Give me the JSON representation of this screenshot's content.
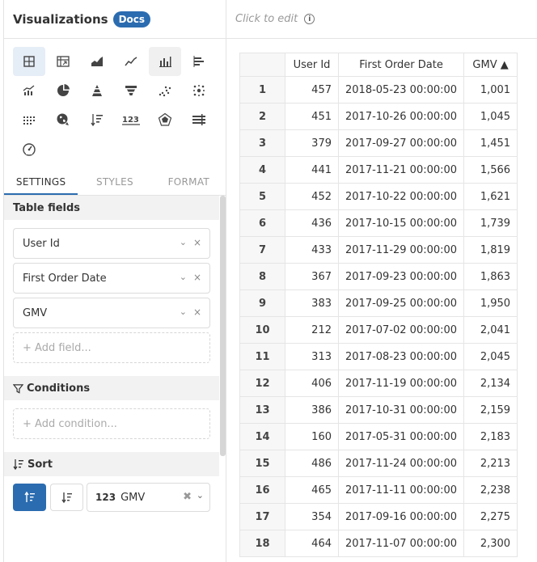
{
  "panel": {
    "title": "Visualizations",
    "docs_badge": "Docs"
  },
  "viz_icons": [
    "table-icon",
    "pivot-table-icon",
    "area-chart-icon",
    "line-chart-icon",
    "column-chart-icon",
    "bar-chart-icon",
    "combo-chart-icon",
    "pie-chart-icon",
    "pyramid-chart-icon",
    "funnel-chart-icon",
    "scatter-chart-icon",
    "heatmap-icon",
    "dot-matrix-icon",
    "geo-map-icon",
    "sorted-list-icon",
    "number-metric-icon",
    "radar-chart-icon",
    "bullet-chart-icon",
    "gauge-icon"
  ],
  "tabs": {
    "settings": "SETTINGS",
    "styles": "STYLES",
    "format": "FORMAT"
  },
  "table_fields": {
    "heading": "Table fields",
    "items": [
      {
        "label": "User Id"
      },
      {
        "label": "First Order Date"
      },
      {
        "label": "GMV"
      }
    ],
    "add_placeholder": "+ Add field..."
  },
  "conditions": {
    "heading": "Conditions",
    "add_placeholder": "+ Add condition..."
  },
  "sort": {
    "heading": "Sort",
    "field_type": "123",
    "field_label": "GMV"
  },
  "editor": {
    "placeholder": "Click to edit",
    "info_glyph": "i"
  },
  "table": {
    "columns": [
      "User Id",
      "First Order Date",
      "GMV ▲"
    ],
    "rows": [
      [
        "1",
        "457",
        "2018-05-23 00:00:00",
        "1,001"
      ],
      [
        "2",
        "451",
        "2017-10-26 00:00:00",
        "1,045"
      ],
      [
        "3",
        "379",
        "2017-09-27 00:00:00",
        "1,451"
      ],
      [
        "4",
        "441",
        "2017-11-21 00:00:00",
        "1,566"
      ],
      [
        "5",
        "452",
        "2017-10-22 00:00:00",
        "1,621"
      ],
      [
        "6",
        "436",
        "2017-10-15 00:00:00",
        "1,739"
      ],
      [
        "7",
        "433",
        "2017-11-29 00:00:00",
        "1,819"
      ],
      [
        "8",
        "367",
        "2017-09-23 00:00:00",
        "1,863"
      ],
      [
        "9",
        "383",
        "2017-09-25 00:00:00",
        "1,950"
      ],
      [
        "10",
        "212",
        "2017-07-02 00:00:00",
        "2,041"
      ],
      [
        "11",
        "313",
        "2017-08-23 00:00:00",
        "2,045"
      ],
      [
        "12",
        "406",
        "2017-11-19 00:00:00",
        "2,134"
      ],
      [
        "13",
        "386",
        "2017-10-31 00:00:00",
        "2,159"
      ],
      [
        "14",
        "160",
        "2017-05-31 00:00:00",
        "2,183"
      ],
      [
        "15",
        "486",
        "2017-11-24 00:00:00",
        "2,213"
      ],
      [
        "16",
        "465",
        "2017-11-11 00:00:00",
        "2,238"
      ],
      [
        "17",
        "354",
        "2017-09-16 00:00:00",
        "2,275"
      ],
      [
        "18",
        "464",
        "2017-11-07 00:00:00",
        "2,300"
      ]
    ]
  },
  "colors": {
    "accent": "#2b6cb0",
    "border": "#e3e3e3",
    "section_bg": "#f2f2f2"
  }
}
